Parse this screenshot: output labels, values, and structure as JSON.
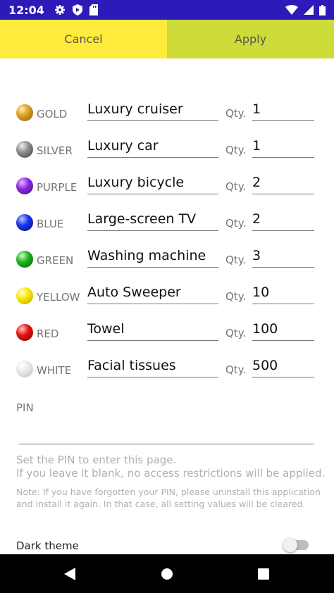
{
  "status_bar": {
    "time": "12:04",
    "left_icons": [
      "gear-icon",
      "shield-icon",
      "sd-card-icon"
    ],
    "right_icons": [
      "wifi-icon",
      "signal-icon",
      "battery-icon"
    ],
    "color": "#2c1ab9"
  },
  "actions": {
    "cancel_label": "Cancel",
    "apply_label": "Apply",
    "cancel_color": "#ffeb3b",
    "apply_color": "#cddc39"
  },
  "prizes": [
    {
      "color_name": "GOLD",
      "item": "Luxury cruiser",
      "qty_label": "Qty.",
      "qty": "1",
      "ball_color": "#d4a017"
    },
    {
      "color_name": "SILVER",
      "item": "Luxury car",
      "qty_label": "Qty.",
      "qty": "1",
      "ball_color": "#8a8a8a"
    },
    {
      "color_name": "PURPLE",
      "item": "Luxury bicycle",
      "qty_label": "Qty.",
      "qty": "2",
      "ball_color": "#7b1fc4"
    },
    {
      "color_name": "BLUE",
      "item": "Large-screen TV",
      "qty_label": "Qty.",
      "qty": "2",
      "ball_color": "#1030e0"
    },
    {
      "color_name": "GREEN",
      "item": "Washing machine",
      "qty_label": "Qty.",
      "qty": "3",
      "ball_color": "#1ea81e"
    },
    {
      "color_name": "YELLOW",
      "item": "Auto Sweeper",
      "qty_label": "Qty.",
      "qty": "10",
      "ball_color": "#f5e400"
    },
    {
      "color_name": "RED",
      "item": "Towel",
      "qty_label": "Qty.",
      "qty": "100",
      "ball_color": "#e01010"
    },
    {
      "color_name": "WHITE",
      "item": "Facial tissues",
      "qty_label": "Qty.",
      "qty": "500",
      "ball_color": "#e4e4e4"
    }
  ],
  "pin": {
    "label": "PIN",
    "value": "",
    "help_line1": "Set the PIN to enter this page.",
    "help_line2": "If you leave it blank, no access restrictions will be applied.",
    "note": "Note: If you have forgotten your PIN, please uninstall this application and install it again. In that case, all setting values will be cleared."
  },
  "dark_theme": {
    "label": "Dark theme",
    "enabled": false
  },
  "nav_bar": {
    "icons": [
      "back-icon",
      "home-icon",
      "recents-icon"
    ]
  }
}
